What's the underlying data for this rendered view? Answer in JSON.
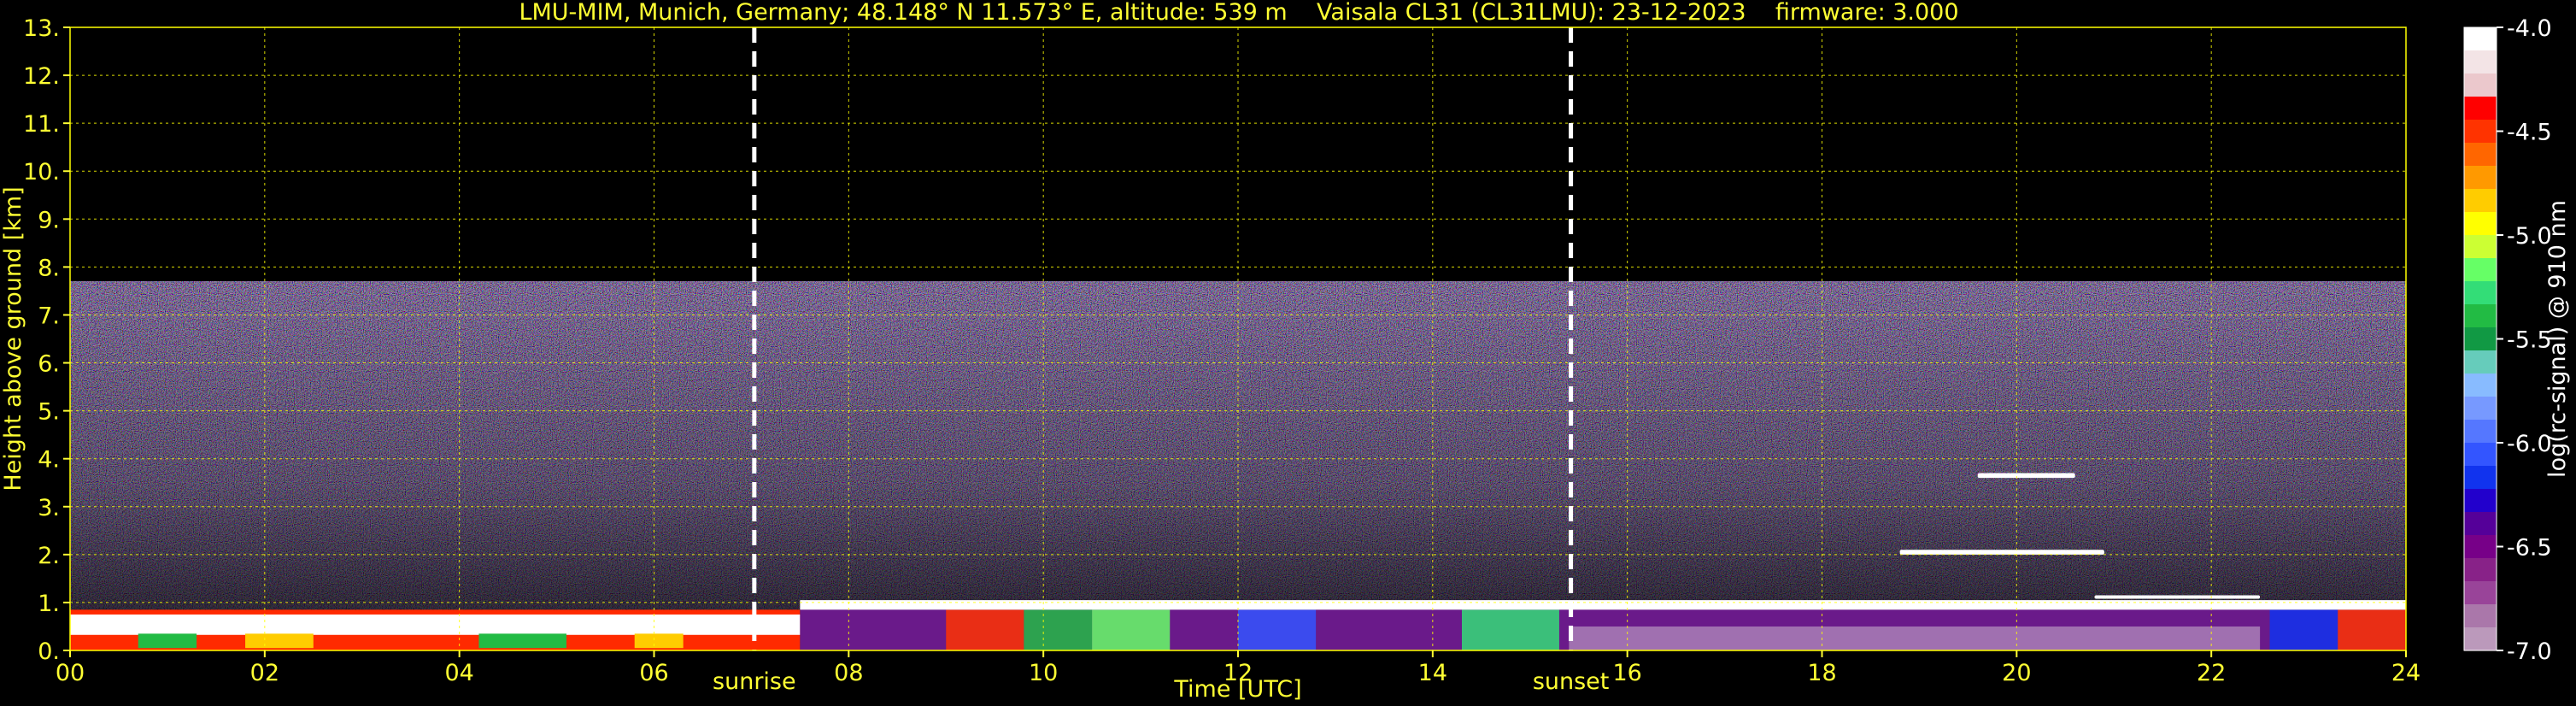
{
  "chart_data": {
    "type": "heatmap",
    "title": "LMU-MIM, Munich, Germany; 48.148° N 11.573° E, altitude: 539 m    Vaisala CL31 (CL31LMU): 23-12-2023    firmware: 3.000",
    "xlabel": "Time [UTC]",
    "ylabel": "Height above ground [km]",
    "xlim": [
      0,
      24
    ],
    "ylim": [
      0,
      13
    ],
    "x_ticks": [
      "00",
      "02",
      "04",
      "06",
      "08",
      "10",
      "12",
      "14",
      "16",
      "18",
      "20",
      "22",
      "24"
    ],
    "y_ticks": [
      "0.",
      "1.",
      "2.",
      "3.",
      "4.",
      "5.",
      "6.",
      "7.",
      "8.",
      "9.",
      "10.",
      "11.",
      "12.",
      "13."
    ],
    "grid": true,
    "grid_color": "#ffff00",
    "text_color": "#ffff33",
    "vertical_markers": [
      {
        "label": "sunrise",
        "x": 7.03
      },
      {
        "label": "sunset",
        "x": 15.42
      }
    ],
    "colorbar": {
      "label": "log(rc-signal) @ 910 nm",
      "range": [
        -7.0,
        -4.0
      ],
      "ticks": [
        "-4.0",
        "-4.5",
        "-5.0",
        "-5.5",
        "-6.0",
        "-6.5",
        "-7.0"
      ],
      "colors": [
        "#ffffff",
        "#f3e4e6",
        "#ebc8cc",
        "#ff0000",
        "#ff3300",
        "#ff6600",
        "#ff9900",
        "#ffcc00",
        "#ffff00",
        "#ccff33",
        "#66ff66",
        "#33dd77",
        "#22bb44",
        "#119944",
        "#66ccbb",
        "#88bbff",
        "#7799ff",
        "#5577ff",
        "#3355ff",
        "#1133ee",
        "#2200cc",
        "#550099",
        "#770088",
        "#882288",
        "#994499",
        "#aa77aa",
        "#bb99bb"
      ]
    },
    "layers": [
      {
        "feature": "noise",
        "x": [
          0,
          24
        ],
        "y": [
          0,
          7.7
        ]
      },
      {
        "feature": "surface aerosol layer",
        "x": [
          0,
          7.5
        ],
        "y": [
          0,
          0.85
        ]
      },
      {
        "feature": "aerosol layer top",
        "x": [
          7.5,
          24
        ],
        "y": [
          0.85,
          1.05
        ]
      },
      {
        "feature": "cloud",
        "x": [
          18.8,
          20.9
        ],
        "y": [
          2.0,
          2.1
        ]
      },
      {
        "feature": "cloud",
        "x": [
          19.6,
          20.6
        ],
        "y": [
          3.6,
          3.7
        ]
      },
      {
        "feature": "cloud",
        "x": [
          20.8,
          22.5
        ],
        "y": [
          1.1,
          1.15
        ]
      }
    ]
  }
}
